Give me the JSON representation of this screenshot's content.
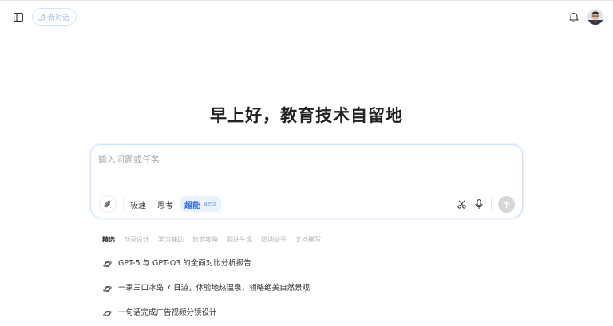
{
  "header": {
    "new_chat_label": "新对话",
    "sidebar_toggle_icon": "sidebar-toggle-icon",
    "notification_icon": "bell-icon"
  },
  "greeting": "早上好，教育技术自留地",
  "composer": {
    "placeholder": "输入问题或任务",
    "modes": [
      {
        "label": "极速"
      },
      {
        "label": "思考"
      },
      {
        "label": "超能",
        "badge": "Beta"
      }
    ],
    "active_mode": "超能"
  },
  "tabs": [
    {
      "label": "精选",
      "active": true
    },
    {
      "label": "创意设计"
    },
    {
      "label": "学习辅助"
    },
    {
      "label": "旅游攻略"
    },
    {
      "label": "网站生成"
    },
    {
      "label": "职场助手"
    },
    {
      "label": "文档撰写"
    }
  ],
  "suggestions": [
    {
      "text": "GPT-5 与 GPT-O3 的全面对比分析报告"
    },
    {
      "text": "一家三口冰岛 7 日游，体验地热温泉，领略绝美自然景观"
    },
    {
      "text": "一句话完成广告视频分镜设计"
    }
  ],
  "colors": {
    "accent": "#2d6cf0",
    "composer_border": "#cfe3fb",
    "send_disabled": "#d6d6d6"
  }
}
